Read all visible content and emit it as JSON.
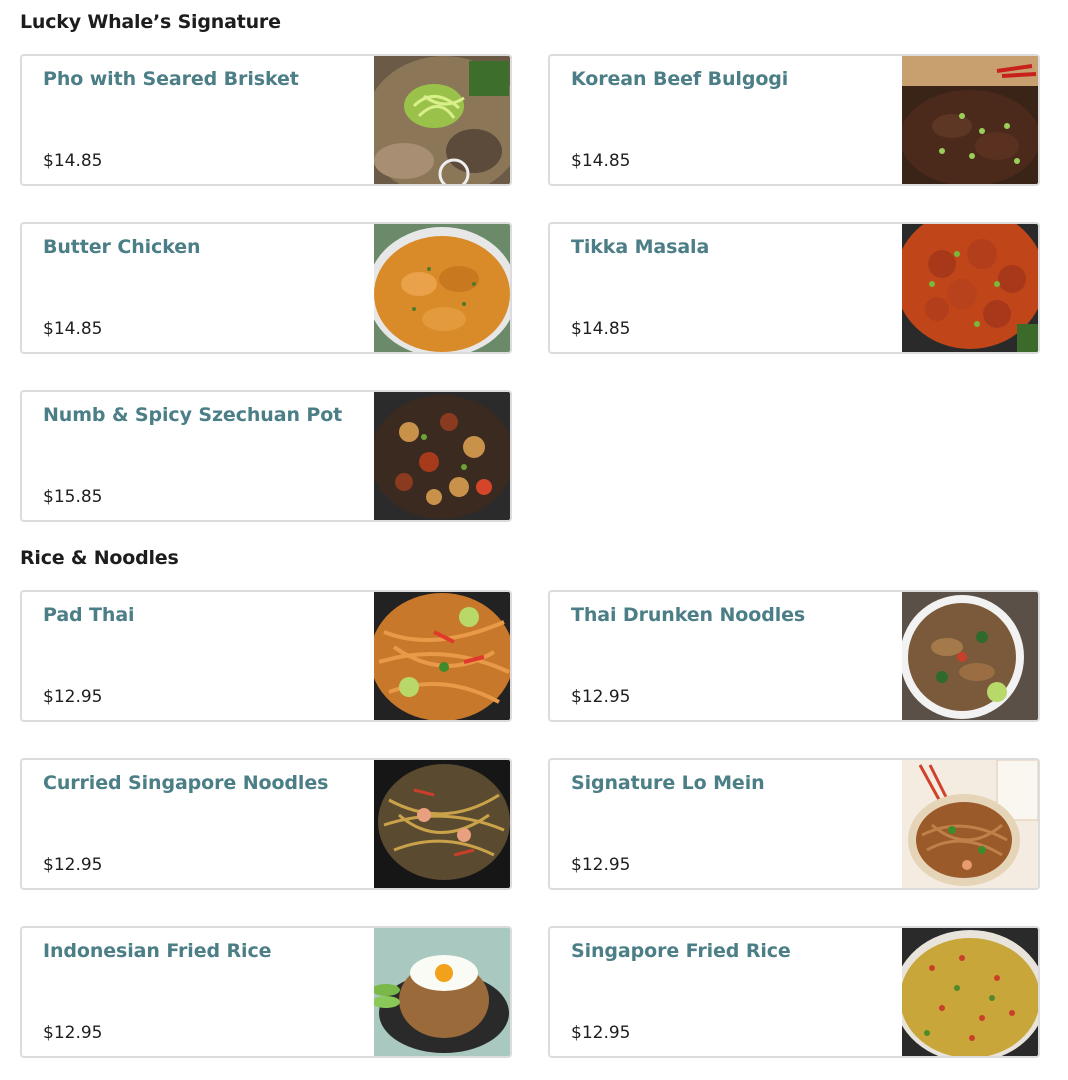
{
  "sections": [
    {
      "title": "Lucky Whale’s Signature",
      "items": [
        {
          "name": "Pho with Seared Brisket",
          "price": "$14.85",
          "image": "pho-photo"
        },
        {
          "name": "Korean Beef Bulgogi",
          "price": "$14.85",
          "image": "bulgogi-photo"
        },
        {
          "name": "Butter Chicken",
          "price": "$14.85",
          "image": "butter-chicken-photo"
        },
        {
          "name": "Tikka Masala",
          "price": "$14.85",
          "image": "tikka-masala-photo"
        },
        {
          "name": "Numb & Spicy Szechuan Pot",
          "price": "$15.85",
          "image": "szechuan-pot-photo"
        }
      ]
    },
    {
      "title": "Rice & Noodles",
      "items": [
        {
          "name": "Pad Thai",
          "price": "$12.95",
          "image": "pad-thai-photo"
        },
        {
          "name": "Thai Drunken Noodles",
          "price": "$12.95",
          "image": "drunken-noodles-photo"
        },
        {
          "name": "Curried Singapore Noodles",
          "price": "$12.95",
          "image": "singapore-noodles-photo"
        },
        {
          "name": "Signature Lo Mein",
          "price": "$12.95",
          "image": "lo-mein-photo"
        },
        {
          "name": "Indonesian Fried Rice",
          "price": "$12.95",
          "image": "indonesian-fried-rice-photo"
        },
        {
          "name": "Singapore Fried Rice",
          "price": "$12.95",
          "image": "singapore-fried-rice-photo"
        }
      ]
    }
  ]
}
